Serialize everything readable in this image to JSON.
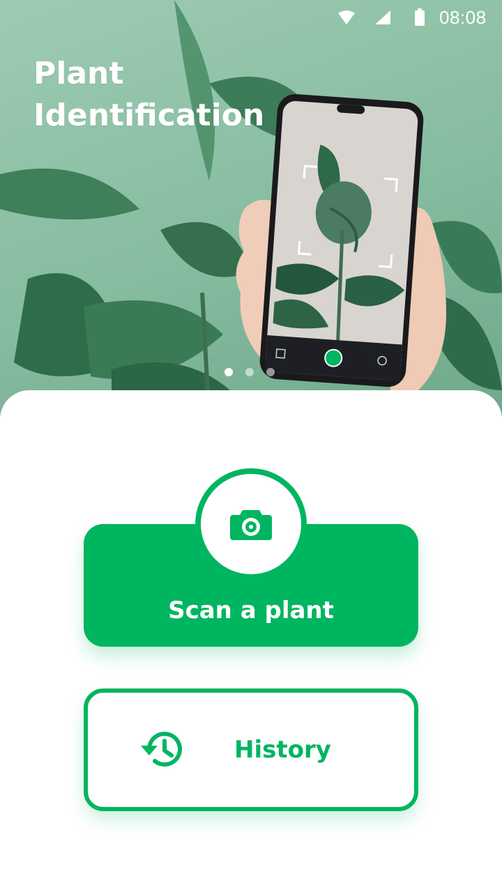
{
  "status_bar": {
    "time": "08:08"
  },
  "hero": {
    "title_line1": "Plant",
    "title_line2": "Identification"
  },
  "carousel": {
    "page_count": 3,
    "active_index": 0
  },
  "actions": {
    "scan_label": "Scan a plant",
    "history_label": "History"
  },
  "colors": {
    "accent": "#00b560",
    "hero_bg": "#9dcbb3",
    "white": "#ffffff"
  },
  "icons": {
    "scan": "camera-icon",
    "history": "history-icon",
    "wifi": "wifi-icon",
    "signal": "signal-icon",
    "battery": "battery-icon"
  }
}
